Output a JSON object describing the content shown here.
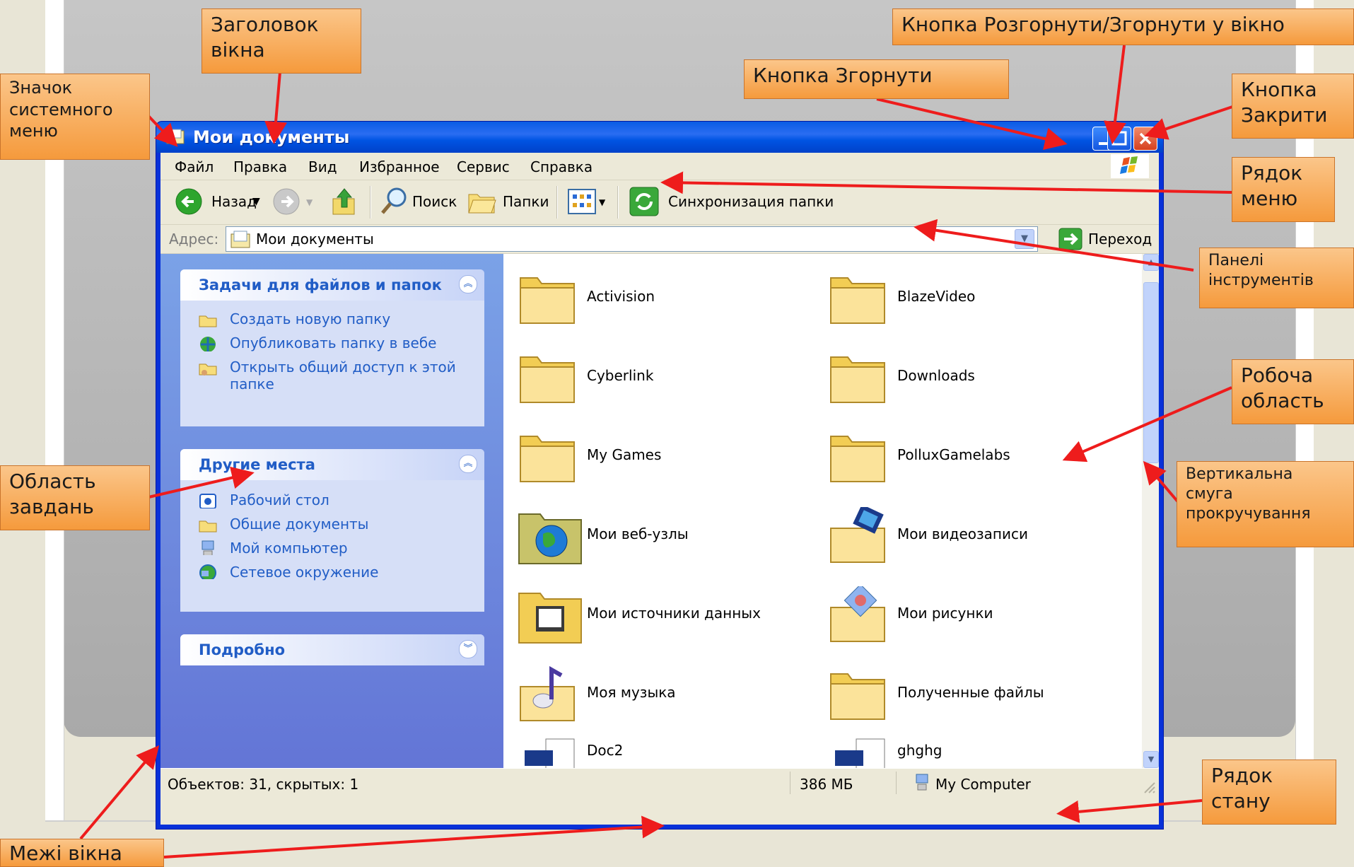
{
  "window": {
    "title": "Мои документы",
    "menu": [
      "Файл",
      "Правка",
      "Вид",
      "Избранное",
      "Сервис",
      "Справка"
    ],
    "toolbar": {
      "back": "Назад",
      "search": "Поиск",
      "folders": "Папки",
      "sync": "Синхронизация папки"
    },
    "address": {
      "label": "Адрес:",
      "value": "Мои документы",
      "go": "Переход"
    },
    "panels": [
      {
        "title": "Задачи для файлов и папок",
        "items": [
          "Создать новую папку",
          "Опубликовать папку в вебе",
          "Открыть общий доступ к этой папке"
        ]
      },
      {
        "title": "Другие места",
        "items": [
          "Рабочий стол",
          "Общие документы",
          "Мой компьютер",
          "Сетевое окружение"
        ]
      },
      {
        "title": "Подробно",
        "items": []
      }
    ],
    "files": [
      {
        "name": "Activision",
        "icon": "folder-icon"
      },
      {
        "name": "BlazeVideo",
        "icon": "folder-icon"
      },
      {
        "name": "Cyberlink",
        "icon": "folder-icon"
      },
      {
        "name": "Downloads",
        "icon": "folder-icon"
      },
      {
        "name": "My Games",
        "icon": "folder-icon"
      },
      {
        "name": "PolluxGamelabs",
        "icon": "folder-icon"
      },
      {
        "name": "Мои веб-узлы",
        "icon": "web-folder-icon"
      },
      {
        "name": "Мои видеозаписи",
        "icon": "video-folder-icon"
      },
      {
        "name": "Мои источники данных",
        "icon": "data-sources-folder-icon"
      },
      {
        "name": "Мои рисунки",
        "icon": "pictures-folder-icon"
      },
      {
        "name": "Моя музыка",
        "icon": "music-folder-icon"
      },
      {
        "name": "Полученные файлы",
        "icon": "folder-icon"
      },
      {
        "name": "Doc2",
        "icon": "document-icon"
      },
      {
        "name": "ghghg",
        "icon": "document-icon"
      }
    ],
    "status": {
      "objects": "Объектов: 31, скрытых: 1",
      "size": "386 МБ",
      "location": "My Computer"
    }
  },
  "annotations": {
    "title": "Заголовок вікна",
    "sysmenu": "Значок системного меню",
    "maximize": "Кнопка Розгорнути/Згорнути у вікно",
    "minimize": "Кнопка Згорнути",
    "close": "Кнопка Закрити",
    "menubar": "Рядок меню",
    "toolbars": "Панелі інструментів",
    "workarea": "Робоча область",
    "taskpane": "Область завдань",
    "scrollbar": "Вертикальна смуга прокручування",
    "statusbar": "Рядок стану",
    "borders": "Межі вікна"
  },
  "colors": {
    "callout": "#f5a045",
    "arrow": "#ee1c1c",
    "titlebar": "#0054e3",
    "taskpane": "#6f8be0"
  }
}
